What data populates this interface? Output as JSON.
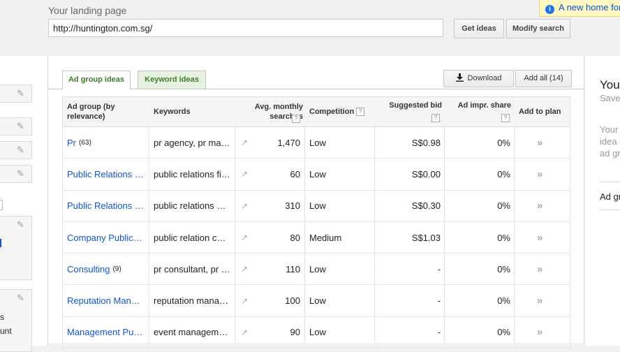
{
  "landing": {
    "label": "Your landing page",
    "url": "http://huntington.com.sg/",
    "get_ideas": "Get ideas",
    "modify_search": "Modify search"
  },
  "notification": {
    "icon": "info-icon",
    "text": "A new home for"
  },
  "left_panel": {
    "texts": [
      "s",
      "unt"
    ]
  },
  "tabs": {
    "ad_group": "Ad group ideas",
    "keyword": "Keyword ideas"
  },
  "actions": {
    "download": "Download",
    "add_all": "Add all (14)"
  },
  "table": {
    "headers": {
      "ad_group": "Ad group (by relevance)",
      "keywords": "Keywords",
      "searches": "Avg. monthly searches",
      "competition": "Competition",
      "bid": "Suggested bid",
      "impr": "Ad impr. share",
      "add": "Add to plan"
    },
    "help_glyph": "?",
    "trend_glyph": "↗",
    "add_glyph": "»",
    "rows": [
      {
        "ad_group": "Pr",
        "count": "(63)",
        "keywords": "pr agency, pr ma…",
        "searches": "1,470",
        "competition": "Low",
        "bid": "S$0.98",
        "impr": "0%"
      },
      {
        "ad_group": "Public Relations …",
        "count": "",
        "keywords": "public relations fi…",
        "searches": "60",
        "competition": "Low",
        "bid": "S$0.00",
        "impr": "0%"
      },
      {
        "ad_group": "Public Relations …",
        "count": "",
        "keywords": "public relations …",
        "searches": "310",
        "competition": "Low",
        "bid": "S$0.30",
        "impr": "0%"
      },
      {
        "ad_group": "Company Public…",
        "count": "",
        "keywords": "public relation c…",
        "searches": "80",
        "competition": "Medium",
        "bid": "S$1.03",
        "impr": "0%"
      },
      {
        "ad_group": "Consulting",
        "count": "(9)",
        "keywords": "pr consultant, pr …",
        "searches": "110",
        "competition": "Low",
        "bid": "-",
        "impr": "0%"
      },
      {
        "ad_group": "Reputation Man…",
        "count": "",
        "keywords": "reputation mana…",
        "searches": "100",
        "competition": "Low",
        "bid": "-",
        "impr": "0%"
      },
      {
        "ad_group": "Management Pu…",
        "count": "",
        "keywords": "event managem…",
        "searches": "90",
        "competition": "Low",
        "bid": "-",
        "impr": "0%"
      }
    ]
  },
  "right_panel": {
    "title": "Your",
    "subtitle": "Save",
    "desc_lines": [
      "Your",
      "idea c",
      "ad gr"
    ],
    "ad_group_label": "Ad gr"
  }
}
